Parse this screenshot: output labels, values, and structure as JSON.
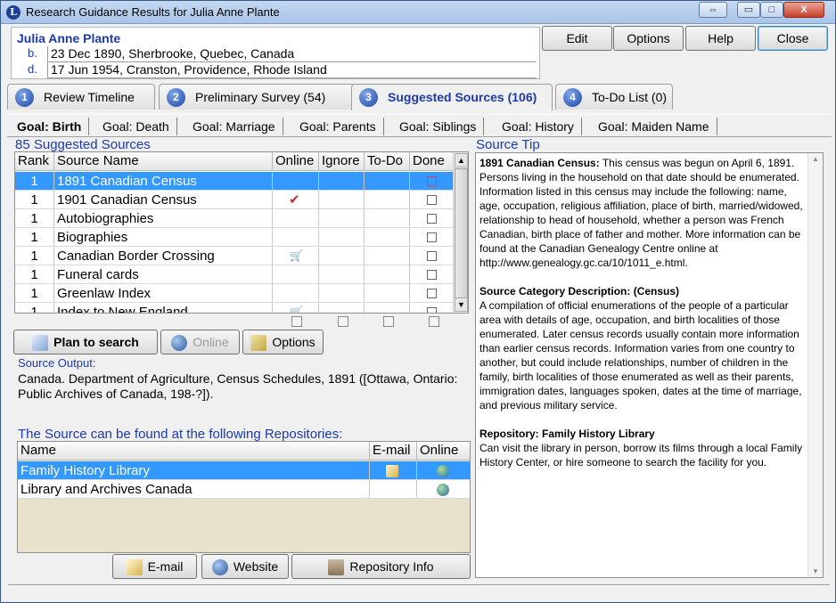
{
  "window": {
    "title": "Research Guidance Results for Julia Anne Plante",
    "restore_glyph": "⇔",
    "minimize_glyph": "▭",
    "maximize_glyph": "□",
    "close_glyph": "X"
  },
  "person": {
    "name": "Julia Anne Plante",
    "birth_label": "b.",
    "birth": "23 Dec 1890, Sherbrooke, Quebec, Canada",
    "death_label": "d.",
    "death": "17 Jun 1954, Cranston, Providence, Rhode Island"
  },
  "top_buttons": {
    "edit": "Edit",
    "options": "Options",
    "help": "Help",
    "close": "Close"
  },
  "tabs": [
    {
      "num": "1",
      "label": "Review Timeline"
    },
    {
      "num": "2",
      "label": "Preliminary Survey (54)"
    },
    {
      "num": "3",
      "label": "Suggested Sources (106)"
    },
    {
      "num": "4",
      "label": "To-Do List (0)"
    }
  ],
  "goals": [
    "Goal: Birth",
    "Goal: Death",
    "Goal: Marriage",
    "Goal: Parents",
    "Goal: Siblings",
    "Goal: History",
    "Goal: Maiden Name"
  ],
  "sources": {
    "count_label": "85 Suggested Sources",
    "columns": [
      "Rank",
      "Source Name",
      "Online",
      "Ignore",
      "To-Do",
      "Done"
    ],
    "rows": [
      {
        "rank": "1",
        "name": "1891 Canadian Census",
        "online": "",
        "selected": true
      },
      {
        "rank": "1",
        "name": "1901 Canadian Census",
        "online": "check"
      },
      {
        "rank": "1",
        "name": "Autobiographies",
        "online": ""
      },
      {
        "rank": "1",
        "name": "Biographies",
        "online": ""
      },
      {
        "rank": "1",
        "name": "Canadian Border Crossing",
        "online": "cart"
      },
      {
        "rank": "1",
        "name": "Funeral cards",
        "online": ""
      },
      {
        "rank": "1",
        "name": "Greenlaw Index",
        "online": ""
      },
      {
        "rank": "1",
        "name": "Index to New England",
        "online": "cart"
      }
    ]
  },
  "source_buttons": {
    "plan": "Plan to search",
    "online": "Online",
    "options": "Options"
  },
  "source_output": {
    "label": "Source Output:",
    "text": "Canada. Department of Agriculture, Census Schedules, 1891 ([Ottawa, Ontario: Public Archives of Canada, 198-?])."
  },
  "repositories": {
    "label": "The Source can be found at the following Repositories:",
    "columns": [
      "Name",
      "E-mail",
      "Online"
    ],
    "rows": [
      {
        "name": "Family History Library",
        "selected": true
      },
      {
        "name": "Library and Archives Canada"
      }
    ]
  },
  "repo_buttons": {
    "email": "E-mail",
    "website": "Website",
    "info": "Repository Info"
  },
  "tip": {
    "label": "Source Tip",
    "p1_head": "1891 Canadian Census:",
    "p1_body": " This census was begun on April 6, 1891. Persons living in the household on that date should be enumerated. Information listed in this census may include the following: name, age, occupation, religious affiliation, place of birth, married/widowed, relationship to head of household, whether a person was French Canadian, birth place of father and mother. More information can be found at the Canadian Genealogy Centre online at http://www.genealogy.gc.ca/10/1011_e.html.",
    "p2_head": "Source Category Description: (Census)",
    "p2_body": "A compilation of official enumerations of the people of a particular area with details of age, occupation, and birth localities of those enumerated. Later census records usually contain more information than earlier census records. Information varies from one country to another, but could include relationships, number of children in the family, birth localities of those enumerated as well as their parents, immigration dates, languages spoken, dates at the time of marriage, and previous military service.",
    "p3_head": "Repository: Family History Library",
    "p3_body": "Can visit the library in person, borrow its films through a local Family History Center, or hire someone to search the facility for you."
  },
  "colors": {
    "accent": "#1c3aa9",
    "selection": "#3399ff"
  }
}
